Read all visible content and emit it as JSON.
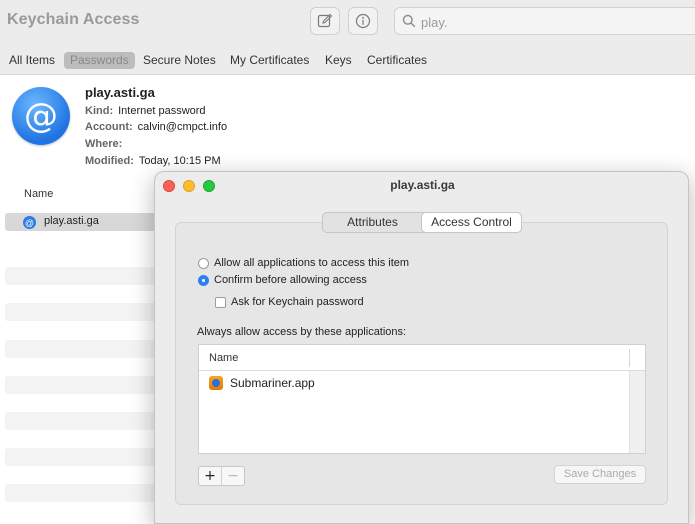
{
  "app": {
    "title": "Keychain Access"
  },
  "search": {
    "placeholder": "play.",
    "value": ""
  },
  "toolbar": {
    "compose_icon": "compose-icon",
    "info_icon": "info-icon"
  },
  "categories": [
    "All Items",
    "Passwords",
    "Secure Notes",
    "My Certificates",
    "Keys",
    "Certificates"
  ],
  "active_category": "Passwords",
  "detail": {
    "icon": "@",
    "name": "play.asti.ga",
    "kind_label": "Kind:",
    "kind_value": "Internet password",
    "account_label": "Account:",
    "account_value": "calvin@cmpct.info",
    "where_label": "Where:",
    "where_value": "",
    "modified_label": "Modified:",
    "modified_value": "Today, 10:15 PM"
  },
  "list": {
    "column_name": "Name",
    "rows": [
      {
        "label": "play.asti.ga",
        "selected": true
      }
    ]
  },
  "dialog": {
    "title": "play.asti.ga",
    "tabs": [
      "Attributes",
      "Access Control"
    ],
    "active_tab": "Access Control",
    "radio_allow_all": "Allow all applications to access this item",
    "radio_confirm": "Confirm before allowing access",
    "check_keychain_password": "Ask for Keychain password",
    "apps_label": "Always allow access by these applications:",
    "apps_column_name": "Name",
    "apps": [
      "Submariner.app"
    ],
    "add_label": "+",
    "remove_label": "−",
    "save_label": "Save Changes"
  }
}
